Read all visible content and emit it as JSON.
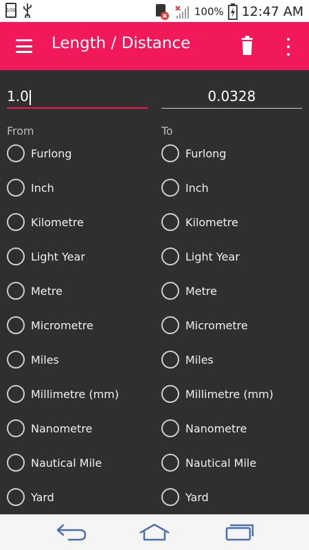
{
  "status_bar": {
    "battery_small": "100",
    "battery_percent": "100%",
    "time": "12:47 AM",
    "usb_icon": "usb-icon",
    "sim_icon": "sim-icon",
    "signal_icon": "signal-icon",
    "battery_icon": "battery-charging-icon"
  },
  "app_bar": {
    "title": "Length / Distance",
    "menu_icon": "menu-icon",
    "delete_icon": "trash-icon",
    "more_icon": "more-vert-icon",
    "color": "#f2195a"
  },
  "converter": {
    "from_value": "1.0",
    "to_value": "0.0328",
    "from_label": "From",
    "to_label": "To"
  },
  "units": [
    "Furlong",
    "Inch",
    "Kilometre",
    "Light Year",
    "Metre",
    "Micrometre",
    "Miles",
    "Millimetre (mm)",
    "Nanometre",
    "Nautical Mile",
    "Yard"
  ],
  "nav_bar": {
    "back_icon": "back-icon",
    "home_icon": "home-icon",
    "recent_icon": "recent-apps-icon"
  }
}
